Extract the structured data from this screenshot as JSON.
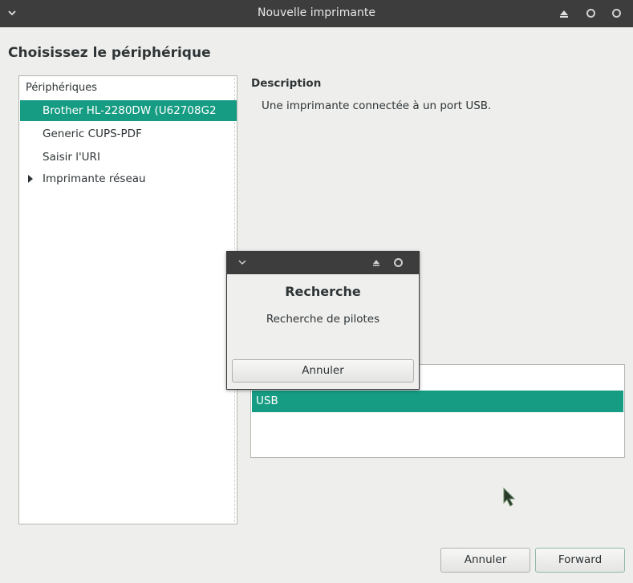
{
  "window": {
    "title": "Nouvelle imprimante"
  },
  "page": {
    "heading": "Choisissez le périphérique"
  },
  "devices": {
    "header": "Périphériques",
    "items": [
      {
        "label": "Brother HL-2280DW (U62708G2"
      },
      {
        "label": "Generic CUPS-PDF"
      },
      {
        "label": "Saisir l'URI"
      },
      {
        "label": "Imprimante réseau"
      }
    ]
  },
  "description": {
    "title": "Description",
    "text": "Une imprimante connectée à un port USB."
  },
  "connection": {
    "selected": "USB"
  },
  "buttons": {
    "cancel": "Annuler",
    "forward": "Forward"
  },
  "dialog": {
    "title": "Recherche",
    "message": "Recherche de pilotes",
    "cancel": "Annuler"
  },
  "colors": {
    "selection": "#169c83",
    "titlebar": "#3d3d3d"
  }
}
